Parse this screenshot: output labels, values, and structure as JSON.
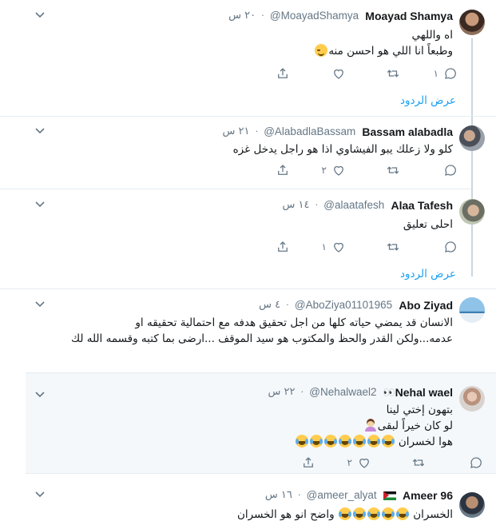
{
  "tweets": [
    {
      "name": "Moayad Shamya",
      "handle": "@MoayadShamya",
      "dot": "·",
      "time": "٢٠ س",
      "lines": [
        "اه واللهي",
        "وطبعاً انا اللي هو احسن منه"
      ],
      "emoji": "relieved-face",
      "reply_count": "١",
      "retweet_count": "",
      "like_count": "",
      "show_replies": "عرض الردود"
    },
    {
      "name": "Bassam alabadla",
      "handle": "@AlabadlaBassam",
      "dot": "·",
      "time": "٢١ س",
      "lines": [
        "كلو ولا زعلك يبو الفيشاوي اذا هو راجل يدخل غزه"
      ],
      "reply_count": "",
      "retweet_count": "",
      "like_count": "٢"
    },
    {
      "name": "Alaa Tafesh",
      "handle": "@alaatafesh",
      "dot": "·",
      "time": "١٤ س",
      "lines": [
        "احلى تعليق"
      ],
      "reply_count": "",
      "retweet_count": "",
      "like_count": "١",
      "show_replies": "عرض الردود"
    },
    {
      "name": "Abo Ziyad",
      "handle": "@AboZiya01101965",
      "dot": "·",
      "time": "٤ س",
      "lines": [
        "الانسان قد يمضي حياته كلها من اجل تحقيق هدفه مع احتمالية تحقيقه او",
        "عدمه...ولكن القدر والحظ والمكتوب هو سيد الموقف ...ارضى بما كتبه وقسمه الله لك"
      ],
      "reply_count": "",
      "retweet_count": "",
      "like_count": ""
    },
    {
      "name": "Nehal wael",
      "name_emoji": "👀",
      "handle": "@Nehalwael2",
      "dot": "·",
      "time": "٢٢ س",
      "lines": [
        "بتهون إختي لينا",
        "لو كان خيراً لبقى",
        "هوا لخسران"
      ],
      "reply_count": "",
      "retweet_count": "",
      "like_count": "٢"
    },
    {
      "name": "Ameer 96",
      "handle": "@ameer_alyat",
      "dot": "·",
      "time": "١٦ س",
      "lines": [
        "الخسران",
        "واضح انو هو الخسران"
      ]
    }
  ],
  "icons": {
    "reply": "reply-icon",
    "retweet": "retweet-icon",
    "like": "heart-icon",
    "share": "share-icon",
    "more": "chevron-down-icon"
  },
  "colors": {
    "link": "#1da1f2",
    "muted": "#657786",
    "text": "#14171a",
    "highlight_bg": "#f5f8fa"
  }
}
